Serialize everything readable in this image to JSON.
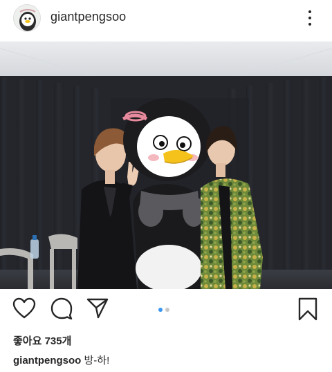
{
  "post": {
    "username": "giantpengsoo",
    "likes_text": "좋아요 735개",
    "caption_user": "giantpengsoo",
    "caption_text": "방-하!",
    "carousel": {
      "count": 2,
      "active": 1
    }
  },
  "icons": {
    "more": "more-vertical-icon",
    "like": "heart-icon",
    "comment": "comment-bubble-icon",
    "share": "send-paper-plane-icon",
    "save": "bookmark-icon"
  },
  "colors": {
    "text": "#262626",
    "active_dot": "#3897f0",
    "inactive_dot": "#c7c7c7"
  }
}
